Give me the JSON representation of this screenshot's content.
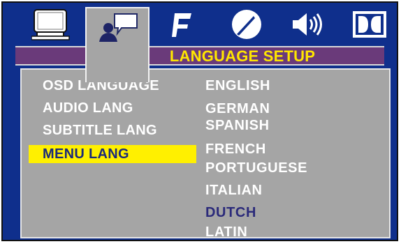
{
  "tabs": [
    {
      "name": "monitor-icon",
      "active": false
    },
    {
      "name": "language-user-icon",
      "active": true
    },
    {
      "name": "audio-note-icon",
      "active": false
    },
    {
      "name": "video-gauge-icon",
      "active": false
    },
    {
      "name": "speaker-icon",
      "active": false
    },
    {
      "name": "dolby-icon",
      "active": false
    }
  ],
  "header": {
    "title": "LANGUAGE SETUP"
  },
  "menu": {
    "items": [
      "OSD LANGUAGE",
      "AUDIO LANG",
      "SUBTITLE LANG",
      "MENU LANG"
    ],
    "selected_index": 3
  },
  "languages": {
    "items": [
      "ENGLISH",
      "GERMAN",
      "SPANISH",
      "FRENCH",
      "PORTUGUESE",
      "ITALIAN",
      "DUTCH",
      "LATIN"
    ],
    "current_index": 6
  },
  "colors": {
    "background": "#0f2f8c",
    "panel": "#a5a5a5",
    "title_bar": "#6a3a7a",
    "title_text": "#ffe600",
    "highlight": "#fff000",
    "highlight_text": "#1a2a7a",
    "current_language": "#2b2a7a"
  }
}
